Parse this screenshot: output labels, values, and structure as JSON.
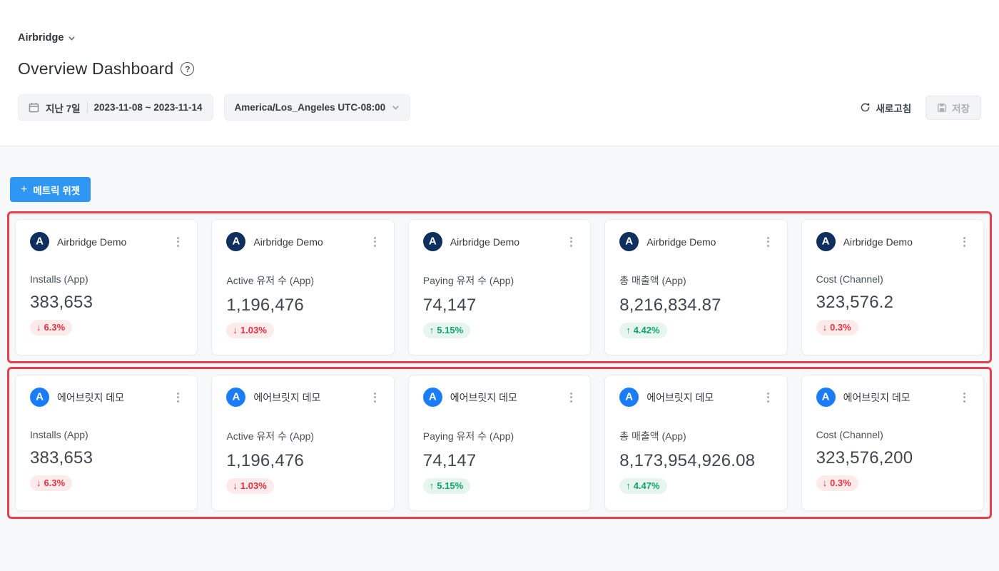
{
  "header": {
    "workspace_name": "Airbridge",
    "page_title": "Overview Dashboard"
  },
  "toolbar": {
    "date_preset": "지난 7일",
    "date_range": "2023-11-08 ~ 2023-11-14",
    "timezone": "America/Los_Angeles UTC-08:00",
    "refresh_label": "새로고침",
    "save_label": "저장"
  },
  "content": {
    "add_metric_widget_label": "메트릭 위젯",
    "plus_icon": "+"
  },
  "colors": {
    "accent_blue": "#2f96f3",
    "row_highlight_outline": "#e8404b",
    "logo_navy": "#0f2f5f",
    "logo_blue": "#1b7cf7",
    "delta_down_text": "#e62e3d",
    "delta_down_bg": "#fdebec",
    "delta_up_text": "#0aa468",
    "delta_up_bg": "#e6f6ee"
  },
  "rows": [
    {
      "cards": [
        {
          "app_name": "Airbridge Demo",
          "logo": "navy",
          "metric": "Installs (App)",
          "value": "383,653",
          "delta": {
            "direction": "down",
            "arrow": "↓",
            "text": "6.3%"
          }
        },
        {
          "app_name": "Airbridge Demo",
          "logo": "navy",
          "metric": "Active 유저 수 (App)",
          "value": "1,196,476",
          "delta": {
            "direction": "down",
            "arrow": "↓",
            "text": "1.03%"
          }
        },
        {
          "app_name": "Airbridge Demo",
          "logo": "navy",
          "metric": "Paying 유저 수 (App)",
          "value": "74,147",
          "delta": {
            "direction": "up",
            "arrow": "↑",
            "text": "5.15%"
          }
        },
        {
          "app_name": "Airbridge Demo",
          "logo": "navy",
          "metric": "총 매출액 (App)",
          "value": "8,216,834.87",
          "delta": {
            "direction": "up",
            "arrow": "↑",
            "text": "4.42%"
          }
        },
        {
          "app_name": "Airbridge Demo",
          "logo": "navy",
          "metric": "Cost (Channel)",
          "value": "323,576.2",
          "delta": {
            "direction": "down",
            "arrow": "↓",
            "text": "0.3%"
          }
        }
      ]
    },
    {
      "cards": [
        {
          "app_name": "에어브릿지 데모",
          "logo": "blue",
          "metric": "Installs (App)",
          "value": "383,653",
          "delta": {
            "direction": "down",
            "arrow": "↓",
            "text": "6.3%"
          }
        },
        {
          "app_name": "에어브릿지 데모",
          "logo": "blue",
          "metric": "Active 유저 수 (App)",
          "value": "1,196,476",
          "delta": {
            "direction": "down",
            "arrow": "↓",
            "text": "1.03%"
          }
        },
        {
          "app_name": "에어브릿지 데모",
          "logo": "blue",
          "metric": "Paying 유저 수 (App)",
          "value": "74,147",
          "delta": {
            "direction": "up",
            "arrow": "↑",
            "text": "5.15%"
          }
        },
        {
          "app_name": "에어브릿지 데모",
          "logo": "blue",
          "metric": "총 매출액 (App)",
          "value": "8,173,954,926.08",
          "delta": {
            "direction": "up",
            "arrow": "↑",
            "text": "4.47%"
          }
        },
        {
          "app_name": "에어브릿지 데모",
          "logo": "blue",
          "metric": "Cost (Channel)",
          "value": "323,576,200",
          "delta": {
            "direction": "down",
            "arrow": "↓",
            "text": "0.3%"
          }
        }
      ]
    }
  ]
}
